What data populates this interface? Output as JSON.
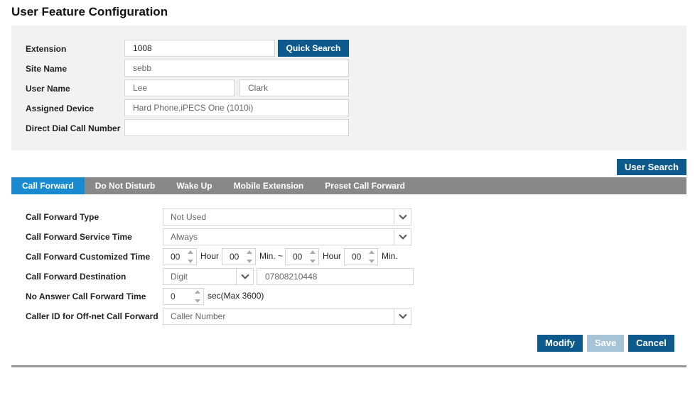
{
  "page": {
    "title": "User Feature Configuration"
  },
  "search": {
    "extension_label": "Extension",
    "extension_value": "1008",
    "quick_search_label": "Quick Search",
    "site_name_label": "Site Name",
    "site_name_value": "sebb",
    "user_name_label": "User Name",
    "first_name_value": "Lee",
    "last_name_value": "Clark",
    "assigned_device_label": "Assigned Device",
    "assigned_device_value": "Hard Phone,iPECS One (1010i)",
    "direct_dial_label": "Direct Dial Call Number",
    "direct_dial_value": ""
  },
  "user_search_label": "User Search",
  "tabs": [
    {
      "label": "Call Forward",
      "active": true
    },
    {
      "label": "Do Not Disturb",
      "active": false
    },
    {
      "label": "Wake Up",
      "active": false
    },
    {
      "label": "Mobile Extension",
      "active": false
    },
    {
      "label": "Preset Call Forward",
      "active": false
    }
  ],
  "call_forward": {
    "type_label": "Call Forward Type",
    "type_value": "Not Used",
    "service_time_label": "Call Forward Service Time",
    "service_time_value": "Always",
    "customized_time_label": "Call Forward Customized Time",
    "start_hour": "00",
    "hour_unit": "Hour",
    "start_min": "00",
    "min_range_unit": "Min. ~",
    "end_hour": "00",
    "end_min": "00",
    "min_unit": "Min.",
    "destination_label": "Call Forward Destination",
    "destination_type": "Digit",
    "destination_value": "07808210448",
    "no_answer_label": "No Answer Call Forward Time",
    "no_answer_value": "0",
    "no_answer_unit": "sec(Max 3600)",
    "caller_id_label": "Caller ID for Off-net Call Forward",
    "caller_id_value": "Caller Number"
  },
  "actions": {
    "modify": "Modify",
    "save": "Save",
    "cancel": "Cancel"
  },
  "colors": {
    "primary": "#0f5a8c",
    "tab_active": "#1a8ad0",
    "tab_bar": "#888888",
    "disabled": "#a7c3d6"
  }
}
